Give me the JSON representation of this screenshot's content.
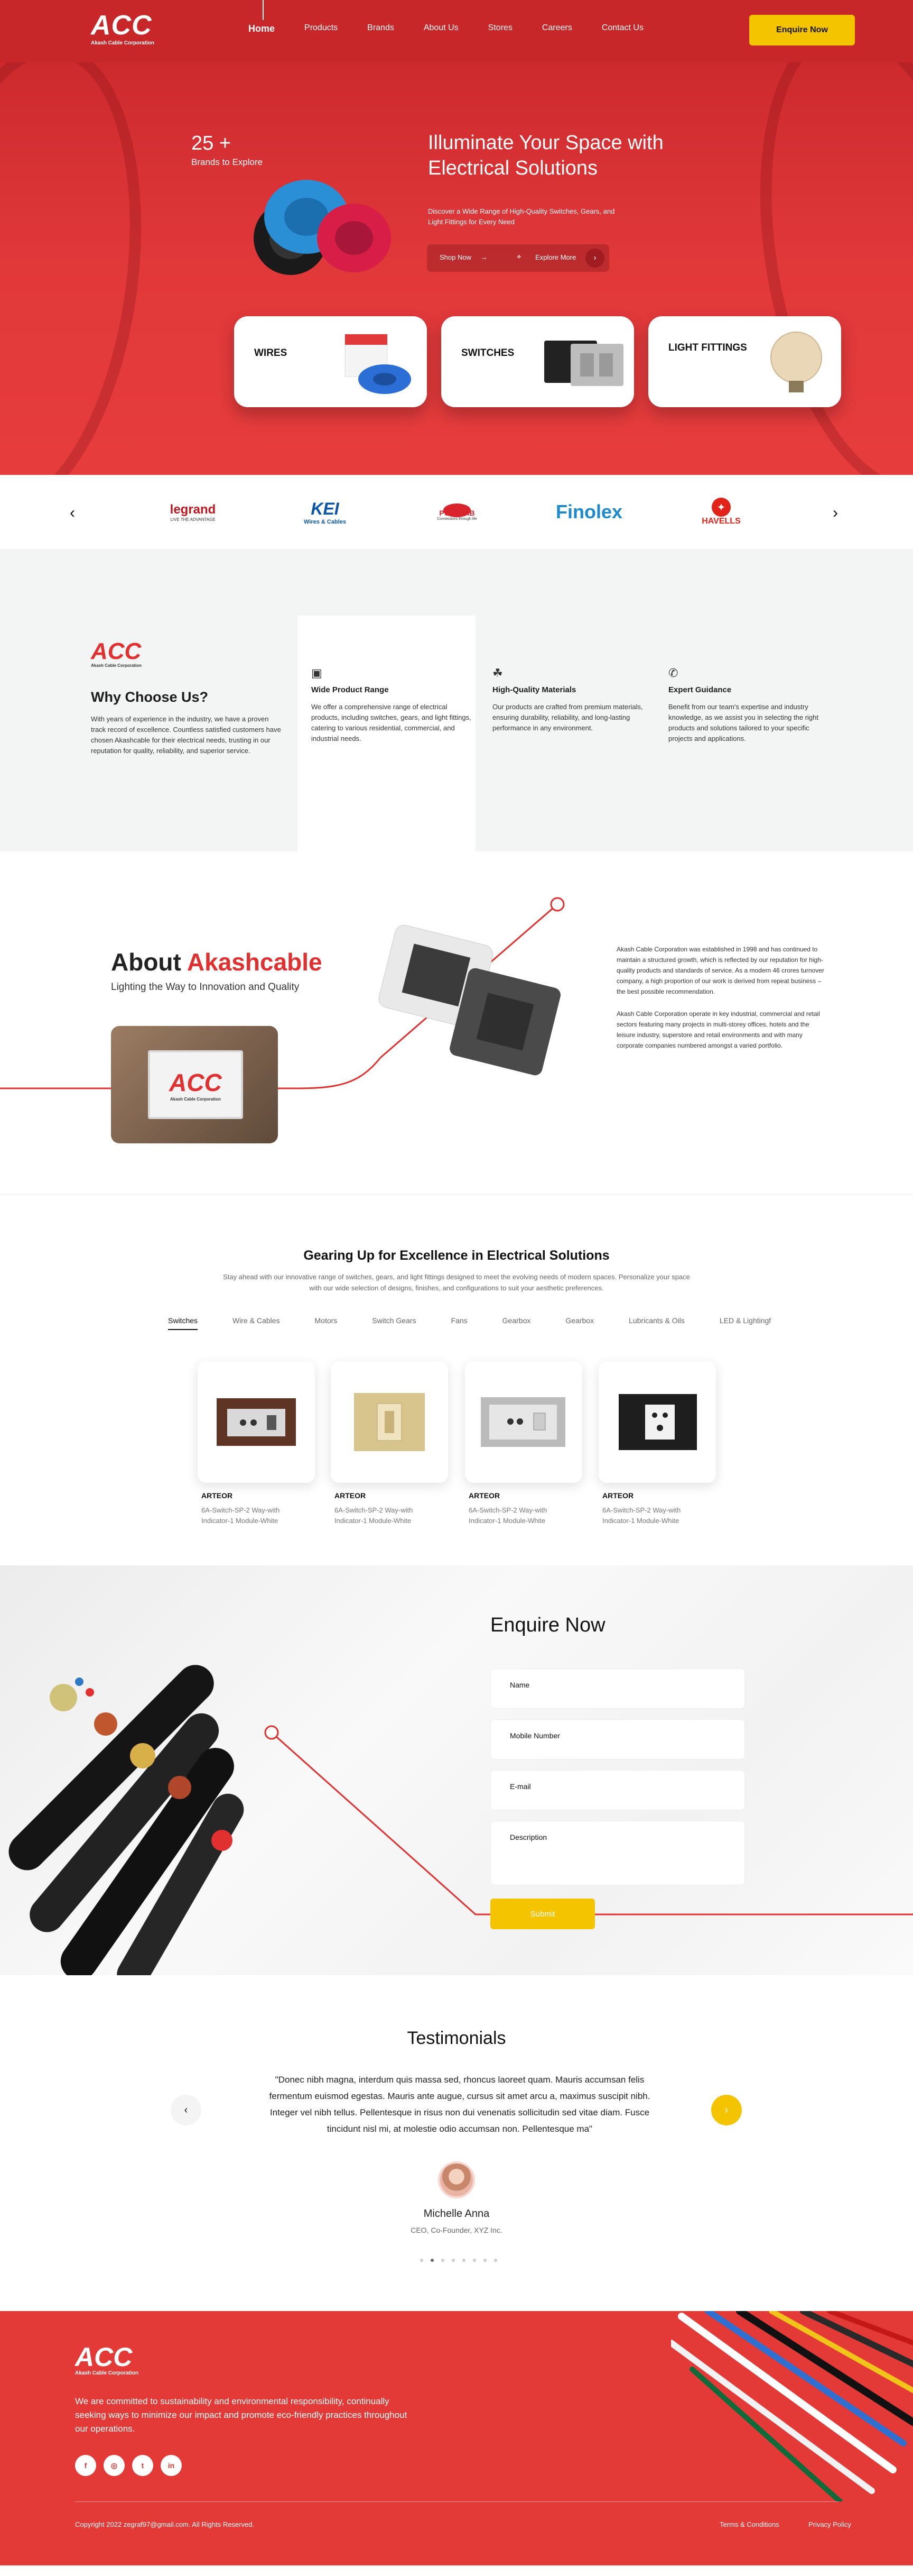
{
  "header": {
    "logo_text": "ACC",
    "logo_sub": "Akash Cable Corporation",
    "nav": [
      "Home",
      "Products",
      "Brands",
      "About Us",
      "Stores",
      "Careers",
      "Contact Us"
    ],
    "cta": "Enquire Now"
  },
  "hero": {
    "count": "25 +",
    "count_label": "Brands to Explore",
    "title": "Illuminate Your Space with Electrical Solutions",
    "description": "Discover a Wide Range of High-Quality Switches, Gears, and Light Fittings for Every Need",
    "shop_now": "Shop Now",
    "explore_more": "Explore More",
    "categories": [
      "WIRES",
      "SWITCHES",
      "LIGHT FITTINGS"
    ]
  },
  "brands": [
    "legrand",
    "KEI",
    "POLYCAB",
    "Finolex",
    "HAVELLS"
  ],
  "brand_taglines": {
    "legrand": "LIVE THE ADVANTAGE",
    "KEI": "Wires & Cables",
    "POLYCAB": "Connections through life"
  },
  "why": {
    "logo_text": "ACC",
    "logo_sub": "Akash Cable Corporation",
    "title": "Why Choose Us?",
    "description": "With years of experience in the industry, we have a proven track record of excellence. Countless satisfied customers have chosen Akashcable for their electrical needs, trusting in our reputation for quality, reliability, and superior service.",
    "features": [
      {
        "title": "Wide Product Range",
        "text": "We offer a comprehensive range of electrical products, including switches, gears, and light fittings, catering to various residential, commercial, and industrial needs."
      },
      {
        "title": "High-Quality Materials",
        "text": "Our products are crafted from premium materials, ensuring durability, reliability, and long-lasting performance in any environment."
      },
      {
        "title": "Expert Guidance",
        "text": "Benefit from our team's expertise and industry knowledge, as we assist you in selecting the right products and solutions tailored to your specific projects and applications."
      }
    ]
  },
  "about": {
    "title_prefix": "About ",
    "title_brand": "Akashcable",
    "subtitle": "Lighting the Way to Innovation and Quality",
    "photo_logo": "ACC",
    "photo_logo_sub": "Akash Cable Corporation",
    "para1": "Akash Cable Corporation was established in 1998 and has continued to maintain a structured growth, which is reflected by our reputation for high-quality products and standards of service. As a modern 46 crores turnover company, a high proportion of our work is derived from repeat business – the best possible recommendation.",
    "para2": "Akash Cable Corporation operate in key industrial, commercial and retail sectors featuring many projects in multi-storey offices, hotels and the leisure industry, superstore and retail environments and with many corporate companies numbered amongst a varied portfolio."
  },
  "products": {
    "title": "Gearing Up for Excellence in Electrical Solutions",
    "description": "Stay ahead with our innovative range of switches, gears, and light fittings designed to meet the evolving needs of modern spaces. Personalize your space with our wide selection of designs, finishes, and configurations to suit your aesthetic preferences.",
    "tabs": [
      "Switches",
      "Wire & Cables",
      "Motors",
      "Switch Gears",
      "Fans",
      "Gearbox",
      "Gearbox",
      "Lubricants & Oils",
      "LED & Lightingf"
    ],
    "items": [
      {
        "name": "ARTEOR",
        "desc": "6A-Switch-SP-2 Way-with Indicator-1 Module-White"
      },
      {
        "name": "ARTEOR",
        "desc": "6A-Switch-SP-2 Way-with Indicator-1 Module-White"
      },
      {
        "name": "ARTEOR",
        "desc": "6A-Switch-SP-2 Way-with Indicator-1 Module-White"
      },
      {
        "name": "ARTEOR",
        "desc": "6A-Switch-SP-2 Way-with Indicator-1 Module-White"
      }
    ]
  },
  "enquire": {
    "title": "Enquire Now",
    "fields": [
      "Name",
      "Mobile Number",
      "E-mail",
      "Description"
    ],
    "submit": "Submit"
  },
  "testimonials": {
    "title": "Testimonials",
    "quote": "\"Donec nibh magna, interdum quis massa sed, rhoncus laoreet quam. Mauris accumsan felis fermentum euismod egestas. Mauris ante augue, cursus sit amet arcu a, maximus suscipit nibh. Integer vel nibh tellus. Pellentesque in risus non dui venenatis sollicitudin sed vitae diam. Fusce tincidunt nisl mi, at molestie odio accumsan non. Pellentesque ma\"",
    "name": "Michelle Anna",
    "role": "CEO, Co-Founder, XYZ Inc.",
    "dots": 8,
    "active_dot": 1
  },
  "footer": {
    "logo_text": "ACC",
    "logo_sub": "Akash Cable Corporation",
    "text": "We are committed to sustainability and environmental responsibility, continually seeking ways to minimize our impact and promote eco-friendly practices throughout our operations.",
    "social": [
      "f",
      "◎",
      "t",
      "in"
    ],
    "copyright": "Copyright 2022 zegraf97@gmail.com. All Rights Reserved.",
    "terms": "Terms & Conditions",
    "privacy": "Privacy Policy"
  },
  "colors": {
    "brand_red": "#e43a37",
    "accent_yellow": "#f5c400",
    "dark_red": "#c72729"
  }
}
